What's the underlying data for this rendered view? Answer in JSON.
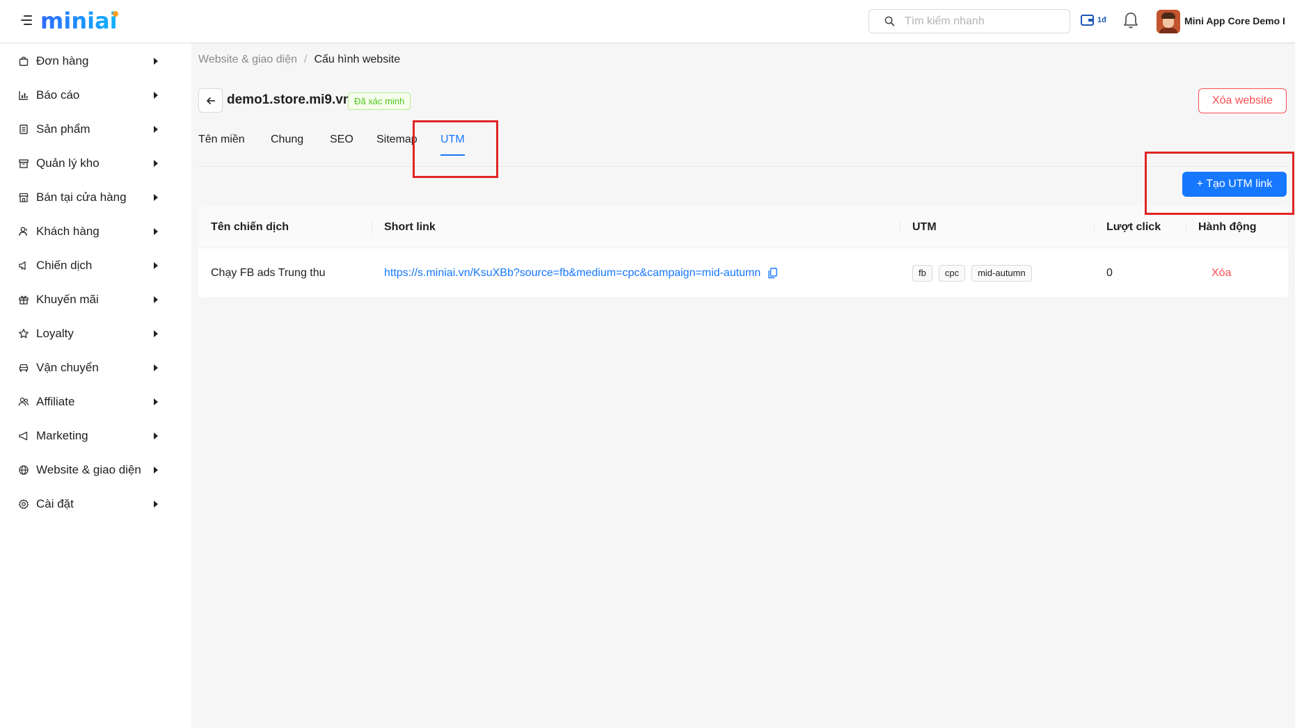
{
  "header": {
    "logo_text": "miniai",
    "search": {
      "placeholder": "Tìm kiếm nhanh",
      "value": ""
    },
    "wallet_label": "1đ",
    "account_name": "Mini App Core Demo I"
  },
  "sidebar": {
    "items": [
      {
        "label": "Đơn hàng",
        "icon": "bag-icon"
      },
      {
        "label": "Báo cáo",
        "icon": "chart-icon"
      },
      {
        "label": "Sản phẩm",
        "icon": "book-icon"
      },
      {
        "label": "Quản lý kho",
        "icon": "archive-icon"
      },
      {
        "label": "Bán tại cửa hàng",
        "icon": "shop-icon"
      },
      {
        "label": "Khách hàng",
        "icon": "users-icon"
      },
      {
        "label": "Chiến dịch",
        "icon": "sound-icon"
      },
      {
        "label": "Khuyến mãi",
        "icon": "gift-icon"
      },
      {
        "label": "Loyalty",
        "icon": "star-icon"
      },
      {
        "label": "Vận chuyển",
        "icon": "car-icon"
      },
      {
        "label": "Affiliate",
        "icon": "usergroup-icon"
      },
      {
        "label": "Marketing",
        "icon": "megaphone-icon"
      },
      {
        "label": "Website & giao diện",
        "icon": "globe-icon"
      },
      {
        "label": "Cài đặt",
        "icon": "gear-icon"
      }
    ]
  },
  "breadcrumb": {
    "parent": "Website & giao diện",
    "separator": "/",
    "current": "Cấu hình website"
  },
  "site": {
    "domain": "demo1.store.mi9.vn",
    "status_badge": "Đã xác minh",
    "delete_label": "Xóa website"
  },
  "tabs": [
    {
      "label": "Tên miền",
      "active": false
    },
    {
      "label": "Chung",
      "active": false
    },
    {
      "label": "SEO",
      "active": false
    },
    {
      "label": "Sitemap",
      "active": false
    },
    {
      "label": "UTM",
      "active": true
    }
  ],
  "create_utm_label": "+ Tạo UTM link",
  "utm_table": {
    "columns": [
      "Tên chiến dịch",
      "Short link",
      "UTM",
      "Lượt click",
      "Hành động"
    ],
    "rows": [
      {
        "campaign": "Chạy FB ads Trung thu",
        "short_link": "https://s.miniai.vn/KsuXBb?source=fb&medium=cpc&campaign=mid-autumn",
        "utm_tags": [
          "fb",
          "cpc",
          "mid-autumn"
        ],
        "clicks": "0",
        "action": "Xóa"
      }
    ]
  },
  "colors": {
    "primary": "#1677ff",
    "danger": "#ff4d4f",
    "success": "#52c41a",
    "annotation": "#e02424"
  }
}
